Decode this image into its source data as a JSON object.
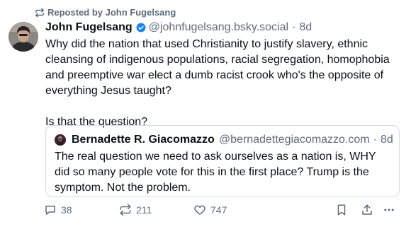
{
  "repost_banner": {
    "text": "Reposted by John Fugelsang"
  },
  "post": {
    "author_name": "John Fugelsang",
    "handle": "@johnfugelsang.bsky.social",
    "separator": "·",
    "age": "8d",
    "paragraphs": [
      "Why did the nation that used Christianity to justify slavery, ethnic cleansing of indigenous populations, racial segregation, homophobia and preemptive war elect a dumb racist crook who's the opposite of everything Jesus taught?",
      "Is that the question?"
    ]
  },
  "quote": {
    "author_name": "Bernadette R. Giacomazzo",
    "handle": "@bernadettegiacomazzo.com",
    "separator": "·",
    "age": "8d",
    "text": "The real question we need to ask ourselves as a nation is, WHY did so many people vote for this in the first place? Trump is the symptom. Not the problem."
  },
  "actions": {
    "reply_count": "38",
    "repost_count": "211",
    "like_count": "747"
  },
  "icons": {
    "repost_banner": "repost-icon",
    "verified": "verified-badge-icon",
    "reply": "reply-icon",
    "repost": "repost-icon",
    "like": "heart-icon",
    "bookmark": "bookmark-icon",
    "share": "share-icon",
    "more": "more-icon"
  },
  "colors": {
    "text": "#0b0f14",
    "muted": "#5f6b7a",
    "verified": "#1083fe",
    "border": "#d4dbe2"
  }
}
